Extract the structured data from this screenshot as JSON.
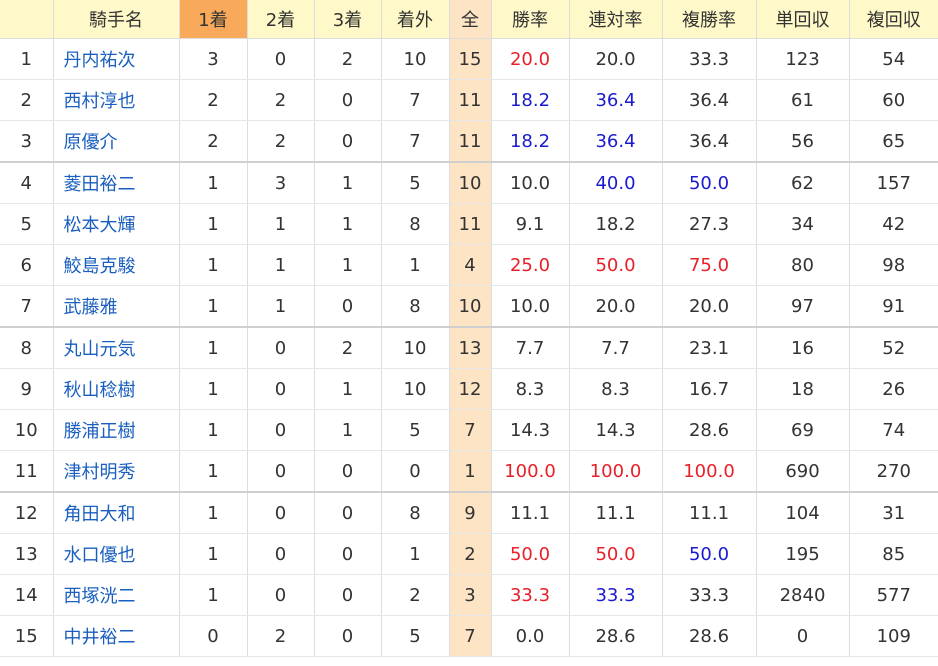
{
  "headers": [
    "",
    "騎手名",
    "1着",
    "2着",
    "3着",
    "着外",
    "全",
    "勝率",
    "連対率",
    "複勝率",
    "単回収",
    "複回収"
  ],
  "colors": {
    "red": "#e8202a",
    "blue": "#1a1ad0",
    "link": "#1a5fbf",
    "header_bg": "#fff8c8",
    "sorted_bg": "#f9a95a",
    "total_bg": "#fce4c4"
  },
  "rows": [
    {
      "rank": "1",
      "name": "丹内祐次",
      "w1": "3",
      "w2": "0",
      "w3": "2",
      "out": "10",
      "total": "15",
      "win": "20.0",
      "quin": "20.0",
      "place": "33.3",
      "tan": "123",
      "fuku": "54",
      "c": [
        "red",
        "plain",
        "plain"
      ]
    },
    {
      "rank": "2",
      "name": "西村淳也",
      "w1": "2",
      "w2": "2",
      "w3": "0",
      "out": "7",
      "total": "11",
      "win": "18.2",
      "quin": "36.4",
      "place": "36.4",
      "tan": "61",
      "fuku": "60",
      "c": [
        "blue",
        "blue",
        "plain"
      ]
    },
    {
      "rank": "3",
      "name": "原優介",
      "w1": "2",
      "w2": "2",
      "w3": "0",
      "out": "7",
      "total": "11",
      "win": "18.2",
      "quin": "36.4",
      "place": "36.4",
      "tan": "56",
      "fuku": "65",
      "c": [
        "blue",
        "blue",
        "plain"
      ]
    },
    {
      "rank": "4",
      "name": "菱田裕二",
      "w1": "1",
      "w2": "3",
      "w3": "1",
      "out": "5",
      "total": "10",
      "win": "10.0",
      "quin": "40.0",
      "place": "50.0",
      "tan": "62",
      "fuku": "157",
      "c": [
        "plain",
        "blue",
        "blue"
      ]
    },
    {
      "rank": "5",
      "name": "松本大輝",
      "w1": "1",
      "w2": "1",
      "w3": "1",
      "out": "8",
      "total": "11",
      "win": "9.1",
      "quin": "18.2",
      "place": "27.3",
      "tan": "34",
      "fuku": "42",
      "c": [
        "plain",
        "plain",
        "plain"
      ]
    },
    {
      "rank": "6",
      "name": "鮫島克駿",
      "w1": "1",
      "w2": "1",
      "w3": "1",
      "out": "1",
      "total": "4",
      "win": "25.0",
      "quin": "50.0",
      "place": "75.0",
      "tan": "80",
      "fuku": "98",
      "c": [
        "red",
        "red",
        "red"
      ]
    },
    {
      "rank": "7",
      "name": "武藤雅",
      "w1": "1",
      "w2": "1",
      "w3": "0",
      "out": "8",
      "total": "10",
      "win": "10.0",
      "quin": "20.0",
      "place": "20.0",
      "tan": "97",
      "fuku": "91",
      "c": [
        "plain",
        "plain",
        "plain"
      ]
    },
    {
      "rank": "8",
      "name": "丸山元気",
      "w1": "1",
      "w2": "0",
      "w3": "2",
      "out": "10",
      "total": "13",
      "win": "7.7",
      "quin": "7.7",
      "place": "23.1",
      "tan": "16",
      "fuku": "52",
      "c": [
        "plain",
        "plain",
        "plain"
      ]
    },
    {
      "rank": "9",
      "name": "秋山稔樹",
      "w1": "1",
      "w2": "0",
      "w3": "1",
      "out": "10",
      "total": "12",
      "win": "8.3",
      "quin": "8.3",
      "place": "16.7",
      "tan": "18",
      "fuku": "26",
      "c": [
        "plain",
        "plain",
        "plain"
      ]
    },
    {
      "rank": "10",
      "name": "勝浦正樹",
      "w1": "1",
      "w2": "0",
      "w3": "1",
      "out": "5",
      "total": "7",
      "win": "14.3",
      "quin": "14.3",
      "place": "28.6",
      "tan": "69",
      "fuku": "74",
      "c": [
        "plain",
        "plain",
        "plain"
      ]
    },
    {
      "rank": "11",
      "name": "津村明秀",
      "w1": "1",
      "w2": "0",
      "w3": "0",
      "out": "0",
      "total": "1",
      "win": "100.0",
      "quin": "100.0",
      "place": "100.0",
      "tan": "690",
      "fuku": "270",
      "c": [
        "red",
        "red",
        "red"
      ]
    },
    {
      "rank": "12",
      "name": "角田大和",
      "w1": "1",
      "w2": "0",
      "w3": "0",
      "out": "8",
      "total": "9",
      "win": "11.1",
      "quin": "11.1",
      "place": "11.1",
      "tan": "104",
      "fuku": "31",
      "c": [
        "plain",
        "plain",
        "plain"
      ]
    },
    {
      "rank": "13",
      "name": "水口優也",
      "w1": "1",
      "w2": "0",
      "w3": "0",
      "out": "1",
      "total": "2",
      "win": "50.0",
      "quin": "50.0",
      "place": "50.0",
      "tan": "195",
      "fuku": "85",
      "c": [
        "red",
        "red",
        "blue"
      ]
    },
    {
      "rank": "14",
      "name": "西塚洸二",
      "w1": "1",
      "w2": "0",
      "w3": "0",
      "out": "2",
      "total": "3",
      "win": "33.3",
      "quin": "33.3",
      "place": "33.3",
      "tan": "2840",
      "fuku": "577",
      "c": [
        "red",
        "blue",
        "plain"
      ]
    },
    {
      "rank": "15",
      "name": "中井裕二",
      "w1": "0",
      "w2": "2",
      "w3": "0",
      "out": "5",
      "total": "7",
      "win": "0.0",
      "quin": "28.6",
      "place": "28.6",
      "tan": "0",
      "fuku": "109",
      "c": [
        "plain",
        "plain",
        "plain"
      ]
    }
  ]
}
